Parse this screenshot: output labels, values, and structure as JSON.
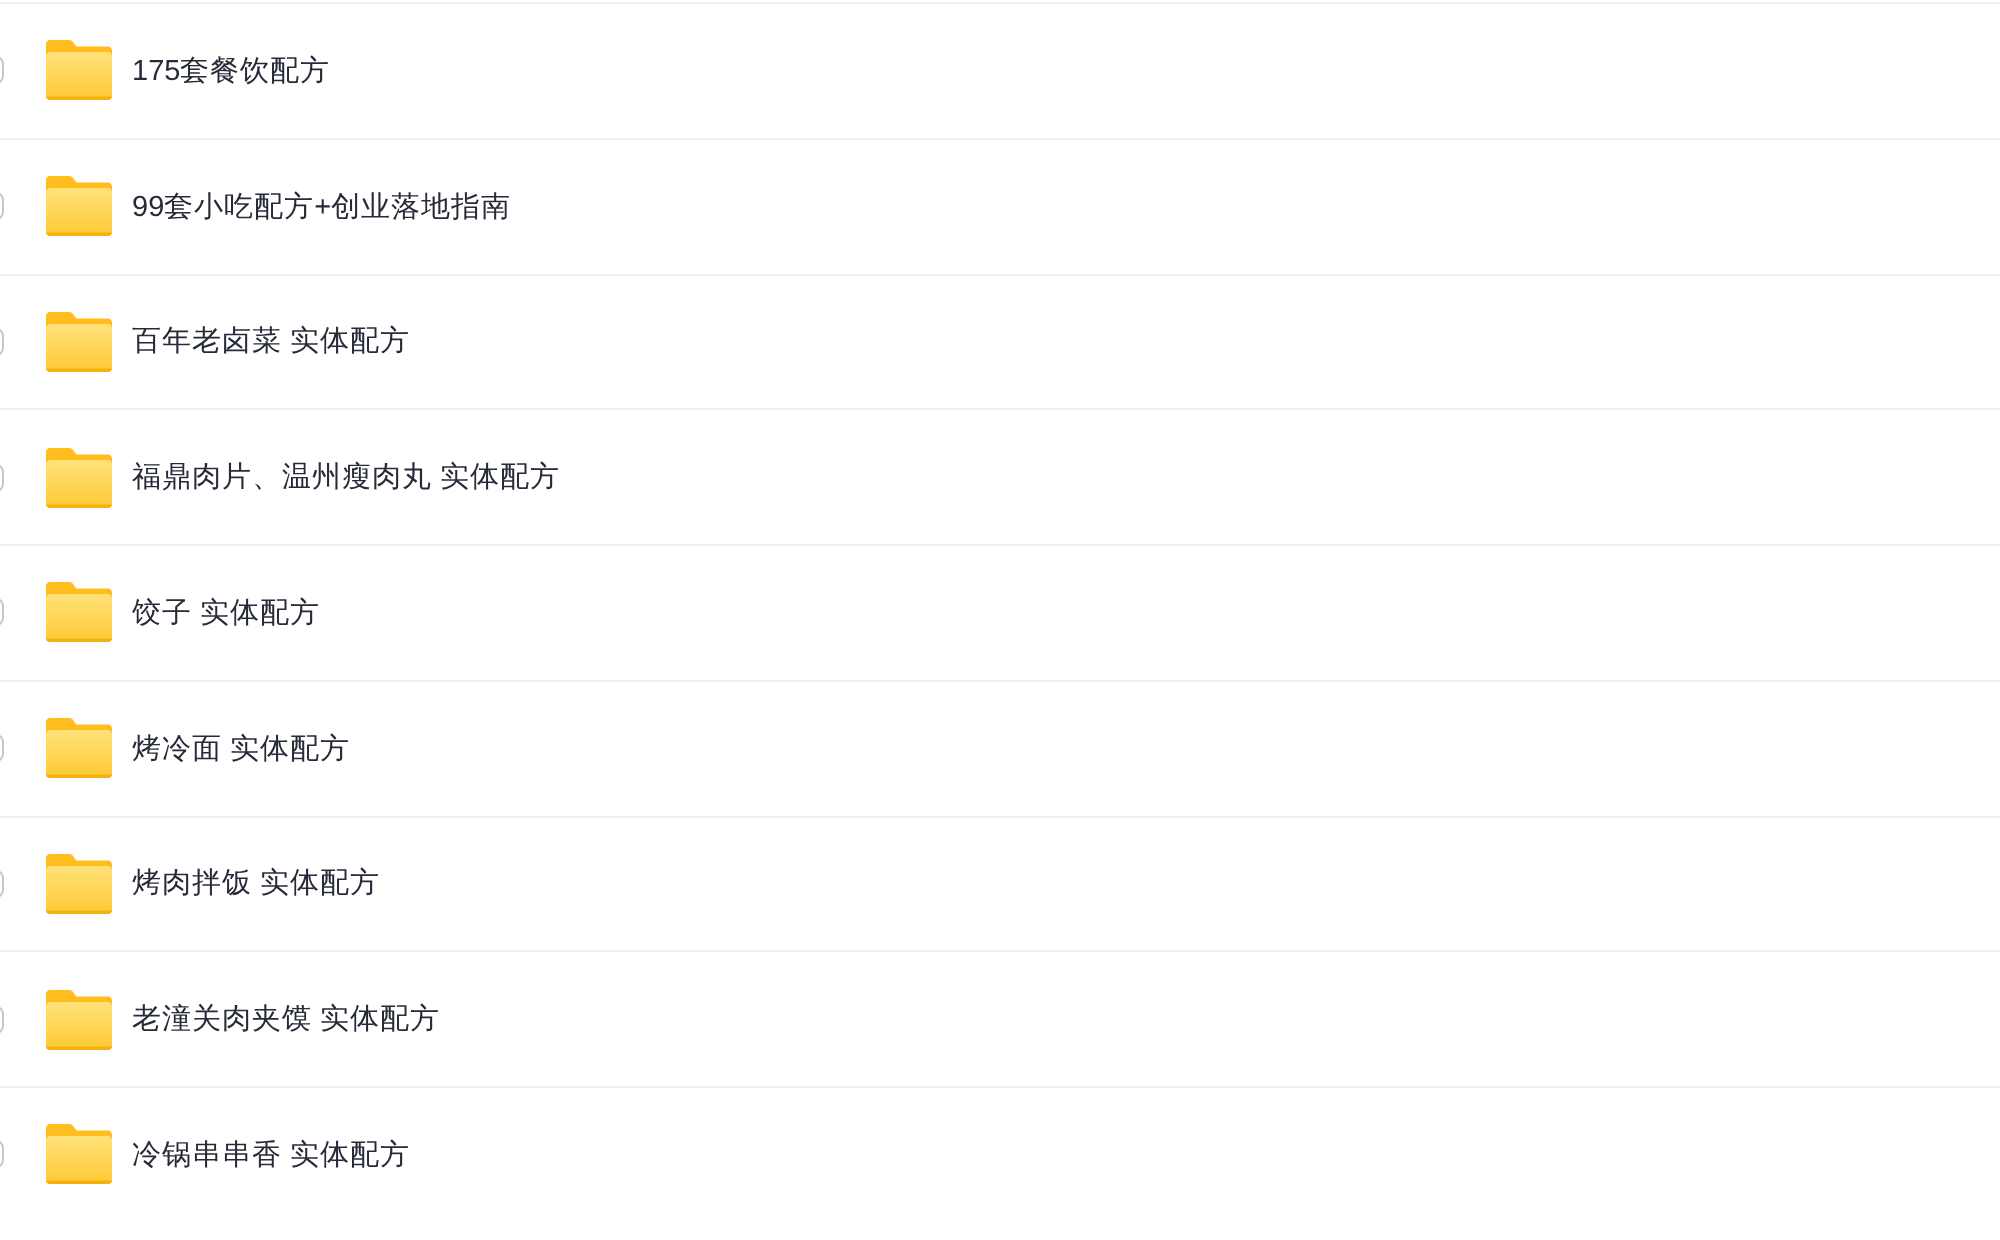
{
  "files": [
    {
      "name": "175套餐饮配方",
      "checked": false
    },
    {
      "name": "99套小吃配方+创业落地指南",
      "checked": false
    },
    {
      "name": "百年老卤菜 实体配方",
      "checked": false
    },
    {
      "name": "福鼎肉片、温州瘦肉丸 实体配方",
      "checked": false
    },
    {
      "name": "饺子 实体配方",
      "checked": false
    },
    {
      "name": "烤冷面 实体配方",
      "checked": false
    },
    {
      "name": "烤肉拌饭 实体配方",
      "checked": false
    },
    {
      "name": "老潼关肉夹馍 实体配方",
      "checked": false
    },
    {
      "name": "冷锅串串香 实体配方",
      "checked": false
    }
  ]
}
